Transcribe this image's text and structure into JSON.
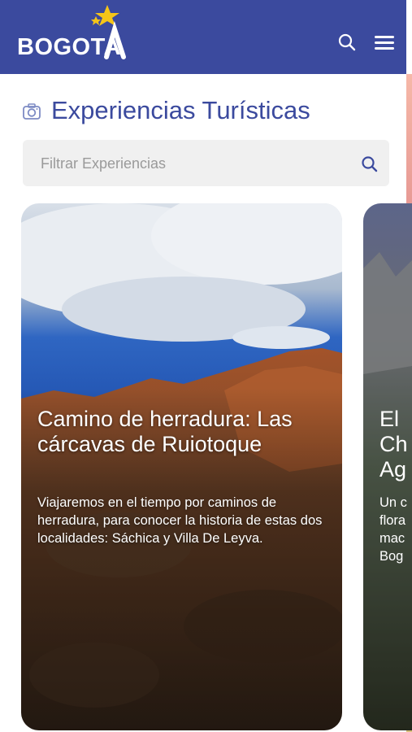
{
  "header": {
    "brand": "BOGOTA",
    "background_color": "#3b4a9e",
    "star_color": "#f5c518",
    "search_icon": "search-icon",
    "menu_icon": "hamburger-menu-icon"
  },
  "main": {
    "title": "Experiencias Turísticas",
    "title_icon": "camera-icon",
    "title_color": "#3b4a9e",
    "filter": {
      "placeholder": "Filtrar Experiencias",
      "value": "",
      "search_icon": "search-icon"
    },
    "cards": [
      {
        "title": "Camino de herradura: Las cárcavas de Ruiotoque",
        "description": "Viajaremos en el tiempo por caminos de herradura, para conocer la historia de estas dos localidades: Sáchica y Villa De Leyva."
      },
      {
        "title_partial": "El\nCh\nAg",
        "description_partial": "Un c\nflora\nmac\nBog"
      }
    ]
  }
}
